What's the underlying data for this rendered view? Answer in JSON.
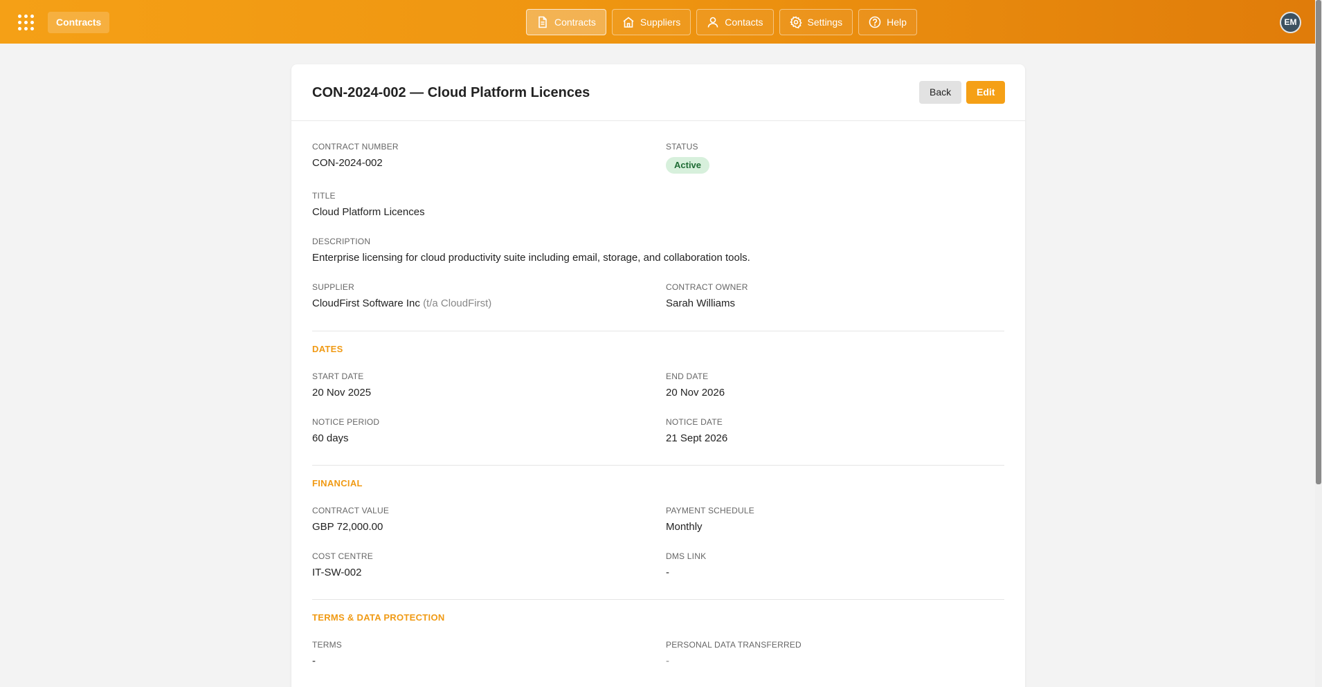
{
  "topbar": {
    "app_title": "Contracts",
    "nav": [
      {
        "label": "Contracts",
        "icon": "document-icon",
        "active": true
      },
      {
        "label": "Suppliers",
        "icon": "building-icon",
        "active": false
      },
      {
        "label": "Contacts",
        "icon": "person-icon",
        "active": false
      },
      {
        "label": "Settings",
        "icon": "gear-icon",
        "active": false
      },
      {
        "label": "Help",
        "icon": "help-icon",
        "active": false
      }
    ],
    "avatar_initials": "EM"
  },
  "header": {
    "title": "CON-2024-002 — Cloud Platform Licences",
    "back_label": "Back",
    "edit_label": "Edit"
  },
  "fields": {
    "contract_number": {
      "label": "Contract Number",
      "value": "CON-2024-002"
    },
    "status": {
      "label": "Status",
      "value": "Active"
    },
    "title": {
      "label": "Title",
      "value": "Cloud Platform Licences"
    },
    "description": {
      "label": "Description",
      "value": "Enterprise licensing for cloud productivity suite including email, storage, and collaboration tools."
    },
    "supplier": {
      "label": "Supplier",
      "value": "CloudFirst Software Inc",
      "trading_as": "(t/a CloudFirst)"
    },
    "contract_owner": {
      "label": "Contract Owner",
      "value": "Sarah Williams"
    }
  },
  "sections": {
    "dates": {
      "title": "Dates",
      "start_date": {
        "label": "Start Date",
        "value": "20 Nov 2025"
      },
      "end_date": {
        "label": "End Date",
        "value": "20 Nov 2026"
      },
      "notice_period": {
        "label": "Notice Period",
        "value": "60 days"
      },
      "notice_date": {
        "label": "Notice Date",
        "value": "21 Sept 2026"
      }
    },
    "financial": {
      "title": "Financial",
      "contract_value": {
        "label": "Contract Value",
        "value": "GBP 72,000.00"
      },
      "payment_schedule": {
        "label": "Payment Schedule",
        "value": "Monthly"
      },
      "cost_centre": {
        "label": "Cost Centre",
        "value": "IT-SW-002"
      },
      "dms_link": {
        "label": "DMS Link",
        "value": "-"
      }
    },
    "terms": {
      "title": "Terms & Data Protection",
      "terms": {
        "label": "Terms",
        "value": "-"
      },
      "personal_data": {
        "label": "Personal Data Transferred",
        "value": "-"
      }
    }
  },
  "colors": {
    "accent": "#f5a016",
    "status_active_bg": "#d7f0dc",
    "status_active_text": "#1e6b34"
  }
}
